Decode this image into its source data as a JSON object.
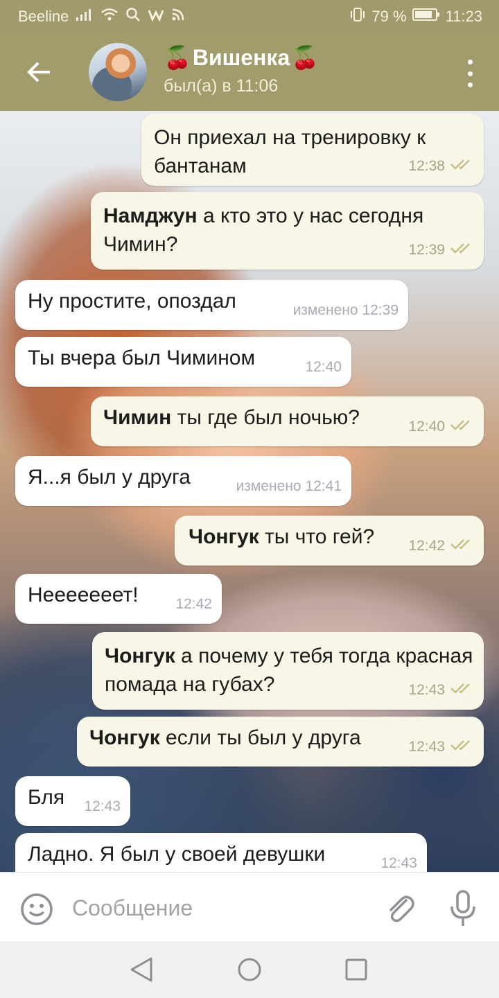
{
  "status_bar": {
    "carrier": "Beeline",
    "battery": "79 %",
    "time": "11:23"
  },
  "header": {
    "title": "Вишенка",
    "title_emoji": "🍒",
    "subtitle": "был(а) в 11:06"
  },
  "messages": [
    {
      "dir": "out",
      "name": "",
      "text": "Он приехал на тренировку к бантанам",
      "time": "12:38",
      "read": true
    },
    {
      "dir": "out",
      "name": "Намджун",
      "text": " а кто это у нас сегодня Чимин?",
      "time": "12:39",
      "read": true
    },
    {
      "dir": "in",
      "name": "",
      "text": "Ну простите, опоздал",
      "time": "изменено 12:39",
      "read": false
    },
    {
      "dir": "in",
      "name": "",
      "text": "Ты вчера был Чимином",
      "time": "12:40",
      "read": false
    },
    {
      "dir": "out",
      "name": "Чимин",
      "text": " ты где был ночью?",
      "time": "12:40",
      "read": true
    },
    {
      "dir": "in",
      "name": "",
      "text": "Я...я был у друга",
      "time": "изменено 12:41",
      "read": false
    },
    {
      "dir": "out",
      "name": "Чонгук",
      "text": " ты что гей?",
      "time": "12:42",
      "read": true
    },
    {
      "dir": "in",
      "name": "",
      "text": "Нееееееет!",
      "time": "12:42",
      "read": false
    },
    {
      "dir": "out",
      "name": "Чонгук",
      "text": " а почему у тебя тогда красная помада на губах?",
      "time": "12:43",
      "read": true
    },
    {
      "dir": "out",
      "name": "Чонгук",
      "text": " если ты был у друга",
      "time": "12:43",
      "read": true
    },
    {
      "dir": "in",
      "name": "",
      "text": "Бля",
      "time": "12:43",
      "read": false
    },
    {
      "dir": "in",
      "name": "",
      "text": "Ладно. Я был у своей девушки",
      "time": "12:43",
      "read": false
    }
  ],
  "input": {
    "placeholder": "Сообщение"
  },
  "colors": {
    "header_bg": "#a29c6d",
    "status_bg": "#a19a6c",
    "outgoing_bubble": "#f8f6e6",
    "incoming_bubble": "#ffffff",
    "read_check": "#c5c089"
  }
}
